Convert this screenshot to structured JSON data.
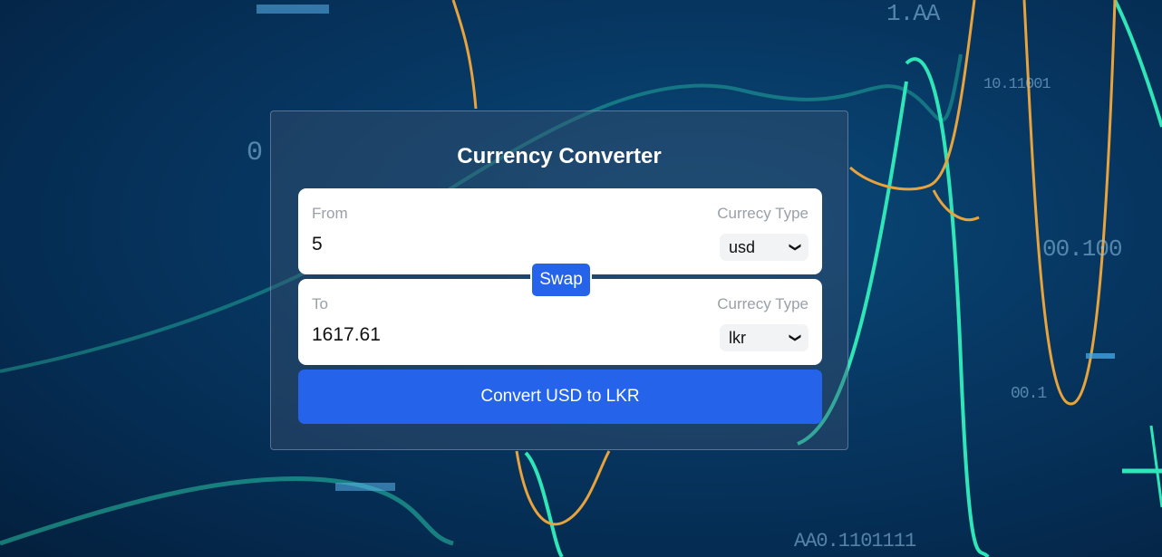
{
  "background": {
    "numbers": [
      "1.AA",
      "10.11001",
      "00.100",
      "00.1",
      "AA0.1101111",
      "0"
    ]
  },
  "converter": {
    "title": "Currency Converter",
    "from": {
      "label": "From",
      "value": "5",
      "type_label": "Currecy Type",
      "currency": "usd"
    },
    "to": {
      "label": "To",
      "value": "1617.61",
      "type_label": "Currecy Type",
      "currency": "lkr"
    },
    "swap_label": "Swap",
    "convert_label": "Convert USD to LKR"
  },
  "colors": {
    "accent": "#2563eb",
    "line_teal": "#2ee6b8",
    "line_orange": "#e8a33c"
  },
  "icons": {
    "select_chevron": "chevron-down-icon"
  }
}
